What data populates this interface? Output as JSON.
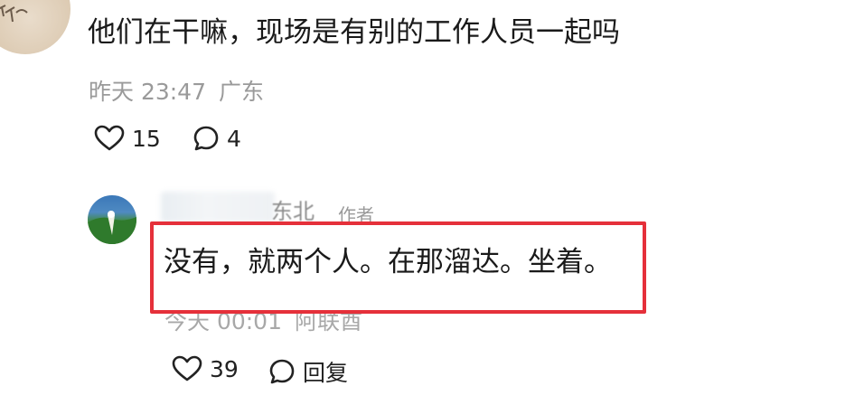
{
  "top_comment": {
    "text": "他们在干嘛，现场是有别的工作人员一起吗",
    "time": "昨天 23:47",
    "location": "广东",
    "likes": "15",
    "replies": "4"
  },
  "reply": {
    "author_partial": "东北",
    "author_badge": "作者",
    "text": "没有，就两个人。在那溜达。坐着。",
    "time": "今天 00:01",
    "location": "阿联酋",
    "likes": "39",
    "reply_label": "回复"
  },
  "colors": {
    "highlight_border": "#e5303a",
    "meta_text": "#9a9a9a"
  },
  "icons": [
    "heart-icon",
    "comment-bubble-icon"
  ]
}
